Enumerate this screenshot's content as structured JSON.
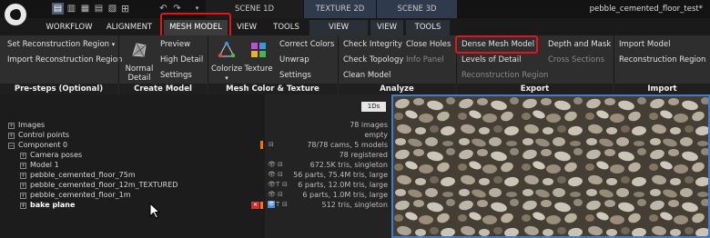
{
  "topbar": {
    "icons": [
      "layout-1-icon",
      "layout-2-icon",
      "layout-3-icon",
      "layout-4-icon",
      "layout-5-icon",
      "undo-icon",
      "redo-icon",
      "dropdown-arrow-icon"
    ],
    "scene_tabs": [
      {
        "label": "SCENE 1D",
        "color": "#1d1d1d"
      },
      {
        "label": "TEXTURE 2D",
        "color": "#2f3b4d"
      },
      {
        "label": "SCENE 3D",
        "color": "#2f3b4d"
      }
    ],
    "title": "pebble_cemented_floor_test*"
  },
  "menu": {
    "items": [
      "WORKFLOW",
      "ALIGNMENT",
      "MESH MODEL",
      "VIEW",
      "TOOLS"
    ],
    "right_items": [
      "VIEW",
      "VIEW",
      "TOOLS"
    ],
    "active": "MESH MODEL"
  },
  "ribbon": {
    "pre_steps": {
      "set_region": "Set Reconstruction Region",
      "set_region_arrow": "▾",
      "import_region": "Import Reconstruction Region"
    },
    "create_model": {
      "normal_detail": [
        "Normal",
        "Detail"
      ],
      "preview": "Preview",
      "high_detail": "High Detail",
      "settings": "Settings"
    },
    "color_texture": {
      "colorize": "Colorize",
      "colorize_arrow": "▾",
      "texture": "Texture",
      "correct_colors": "Correct Colors",
      "unwrap": "Unwrap",
      "settings": "Settings"
    },
    "analyze": {
      "check_integrity": "Check Integrity",
      "check_topology": "Check Topology",
      "clean_model": "Clean Model",
      "close_holes": "Close Holes",
      "info_panel": "Info Panel"
    },
    "export": {
      "dense_mesh": "Dense Mesh Model",
      "levels_of_detail": "Levels of Detail",
      "reconstruction_region": "Reconstruction Region",
      "depth_mask": "Depth and Mask",
      "cross_sections": "Cross Sections"
    },
    "import": {
      "import_model": "Import Model",
      "reconstruction_region": "Reconstruction Region"
    }
  },
  "groups": [
    "Pre-steps (Optional)",
    "Create Model",
    "Mesh Color & Texture",
    "Analyze",
    "Export",
    "Import"
  ],
  "tree": {
    "items": [
      {
        "label": "Images",
        "sign": "+",
        "indent": 0
      },
      {
        "label": "Control points",
        "sign": "+",
        "indent": 0
      },
      {
        "label": "Component 0",
        "sign": "−",
        "indent": 0
      },
      {
        "label": "Camera poses",
        "sign": "+",
        "indent": 1
      },
      {
        "label": "Model 1",
        "sign": "+",
        "indent": 1
      },
      {
        "label": "pebble_cemented_floor_75m",
        "sign": "+",
        "indent": 1
      },
      {
        "label": "pebble_cemented_floor_12m_TEXTURED",
        "sign": "+",
        "indent": 1
      },
      {
        "label": "pebble_cemented_floor_1m",
        "sign": "+",
        "indent": 1
      },
      {
        "label": "bake plane",
        "sign": "+",
        "indent": 1,
        "selected": true
      }
    ]
  },
  "info": {
    "badge": "1Ds",
    "rows": [
      "78 images",
      "empty",
      "78/78 cams, 5 models",
      "78 registered",
      "672.5K tris, singleton",
      "56 parts, 75.4M tris, large",
      "6 parts, 12.0M tris, large",
      "6 parts, 1.0M tris, large",
      "512 tris, singleton"
    ]
  },
  "colors": {
    "accent": "#3d7ccf",
    "highlight": "#e3151c",
    "orange_marker": "#e07b1a"
  }
}
